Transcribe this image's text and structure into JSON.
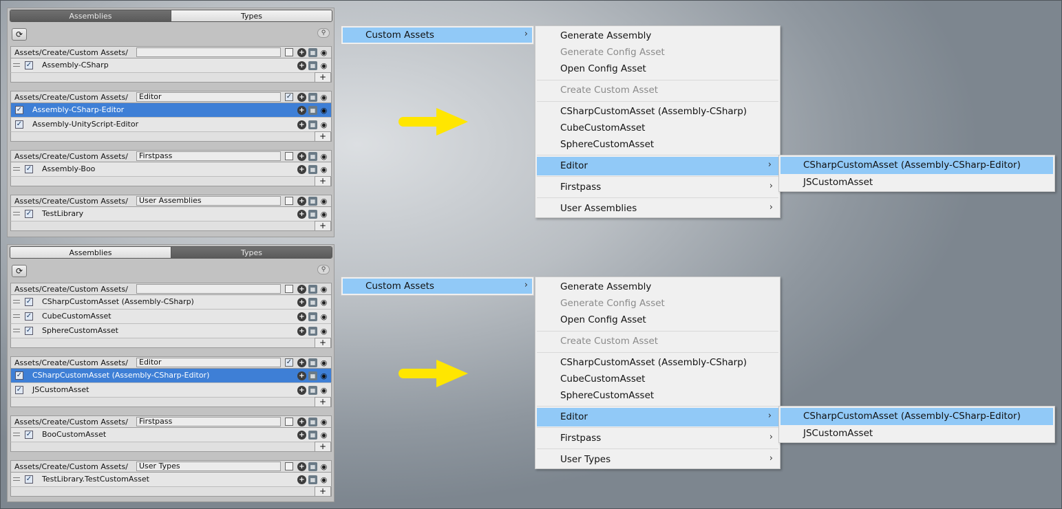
{
  "panels": [
    {
      "tabs": [
        "Assemblies",
        "Types"
      ],
      "active_tab": "Assemblies",
      "groups": [
        {
          "path": "Assets/Create/Custom Assets/",
          "name": "",
          "checked": false,
          "rows": [
            {
              "label": "Assembly-CSharp",
              "selected": false,
              "handle": true
            }
          ]
        },
        {
          "path": "Assets/Create/Custom Assets/",
          "name": "Editor",
          "checked": true,
          "rows": [
            {
              "label": "Assembly-CSharp-Editor",
              "selected": true,
              "handle": false
            },
            {
              "label": "Assembly-UnityScript-Editor",
              "selected": false,
              "handle": false
            }
          ]
        },
        {
          "path": "Assets/Create/Custom Assets/",
          "name": "Firstpass",
          "checked": false,
          "rows": [
            {
              "label": "Assembly-Boo",
              "selected": false,
              "handle": true
            }
          ]
        },
        {
          "path": "Assets/Create/Custom Assets/",
          "name": "User Assemblies",
          "checked": false,
          "rows": [
            {
              "label": "TestLibrary",
              "selected": false,
              "handle": true
            }
          ]
        }
      ]
    },
    {
      "tabs": [
        "Assemblies",
        "Types"
      ],
      "active_tab": "Types",
      "groups": [
        {
          "path": "Assets/Create/Custom Assets/",
          "name": "",
          "checked": false,
          "rows": [
            {
              "label": "CSharpCustomAsset (Assembly-CSharp)",
              "selected": false,
              "handle": true
            },
            {
              "label": "CubeCustomAsset",
              "selected": false,
              "handle": true
            },
            {
              "label": "SphereCustomAsset",
              "selected": false,
              "handle": true
            }
          ]
        },
        {
          "path": "Assets/Create/Custom Assets/",
          "name": "Editor",
          "checked": true,
          "rows": [
            {
              "label": "CSharpCustomAsset (Assembly-CSharp-Editor)",
              "selected": true,
              "handle": false
            },
            {
              "label": "JSCustomAsset",
              "selected": false,
              "handle": false
            }
          ]
        },
        {
          "path": "Assets/Create/Custom Assets/",
          "name": "Firstpass",
          "checked": false,
          "rows": [
            {
              "label": "BooCustomAsset",
              "selected": false,
              "handle": true
            }
          ]
        },
        {
          "path": "Assets/Create/Custom Assets/",
          "name": "User Types",
          "checked": false,
          "rows": [
            {
              "label": "TestLibrary.TestCustomAsset",
              "selected": false,
              "handle": true
            }
          ]
        }
      ]
    }
  ],
  "menus": [
    {
      "root_label": "Custom Assets",
      "items": [
        {
          "label": "Generate Assembly",
          "disabled": false
        },
        {
          "label": "Generate Config Asset",
          "disabled": true
        },
        {
          "label": "Open Config Asset",
          "disabled": false
        },
        {
          "label": "Create Custom Asset",
          "disabled": true
        },
        {
          "label": "CSharpCustomAsset (Assembly-CSharp)",
          "disabled": false
        },
        {
          "label": "CubeCustomAsset",
          "disabled": false
        },
        {
          "label": "SphereCustomAsset",
          "disabled": false
        },
        {
          "label": "Editor",
          "submenu": true,
          "highlighted": true
        },
        {
          "label": "Firstpass",
          "submenu": true
        },
        {
          "label": "User Assemblies",
          "submenu": true
        }
      ],
      "submenu": [
        "CSharpCustomAsset (Assembly-CSharp-Editor)",
        "JSCustomAsset"
      ]
    },
    {
      "root_label": "Custom Assets",
      "items": [
        {
          "label": "Generate Assembly",
          "disabled": false
        },
        {
          "label": "Generate Config Asset",
          "disabled": true
        },
        {
          "label": "Open Config Asset",
          "disabled": false
        },
        {
          "label": "Create Custom Asset",
          "disabled": true
        },
        {
          "label": "CSharpCustomAsset (Assembly-CSharp)",
          "disabled": false
        },
        {
          "label": "CubeCustomAsset",
          "disabled": false
        },
        {
          "label": "SphereCustomAsset",
          "disabled": false
        },
        {
          "label": "Editor",
          "submenu": true,
          "highlighted": true
        },
        {
          "label": "Firstpass",
          "submenu": true
        },
        {
          "label": "User Types",
          "submenu": true
        }
      ],
      "submenu": [
        "CSharpCustomAsset (Assembly-CSharp-Editor)",
        "JSCustomAsset"
      ]
    }
  ],
  "colors": {
    "selection": "#3e7fd6",
    "menu_highlight": "#91c9f7",
    "arrow": "#ffe600"
  },
  "icons": [
    "refresh-icon",
    "search-icon",
    "plus-icon",
    "grid-icon",
    "eye-icon",
    "chevron-right-icon",
    "arrow-right-icon"
  ]
}
